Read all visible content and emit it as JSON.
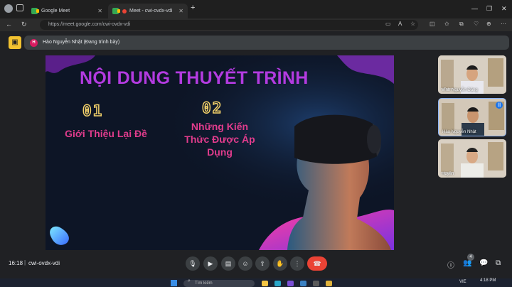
{
  "browser": {
    "tabs": [
      {
        "label": "Google Meet"
      },
      {
        "label": "Meet - cwi-ovdx-vdi"
      }
    ],
    "url": "https://meet.google.com/cwi-ovdx-vdi",
    "new_tab_label": "+"
  },
  "infobar": {
    "presenter_initial": "H",
    "presenter_text": "Hào Nguyễn Nhật (Đang trình bày)"
  },
  "slide": {
    "title": "NỘI DUNG THUYẾT TRÌNH",
    "items": [
      {
        "number": "01",
        "text": "Giới Thiệu Lại Đề"
      },
      {
        "number": "02",
        "text_lines": [
          "Những Kiến",
          "Thức Được Áp",
          "Dụng"
        ]
      }
    ],
    "colors": {
      "title": "#b33be0",
      "item_text": "#e03c8c",
      "numbers": "#f4d26b",
      "background": "#0d1526"
    }
  },
  "participants": [
    {
      "name": "Vĩnh Nguyễn Đặng"
    },
    {
      "name": "Hào Nguyễn Nhật"
    },
    {
      "name": "Huyền"
    }
  ],
  "meet_bar": {
    "time": "16:18",
    "separator": "|",
    "meeting_code": "cwi-ovdx-vdi",
    "people_count": "4",
    "end_call_color": "#ea4335"
  },
  "taskbar": {
    "search_placeholder": "Tìm kiếm",
    "language": "VIE",
    "time": "4:18 PM"
  }
}
